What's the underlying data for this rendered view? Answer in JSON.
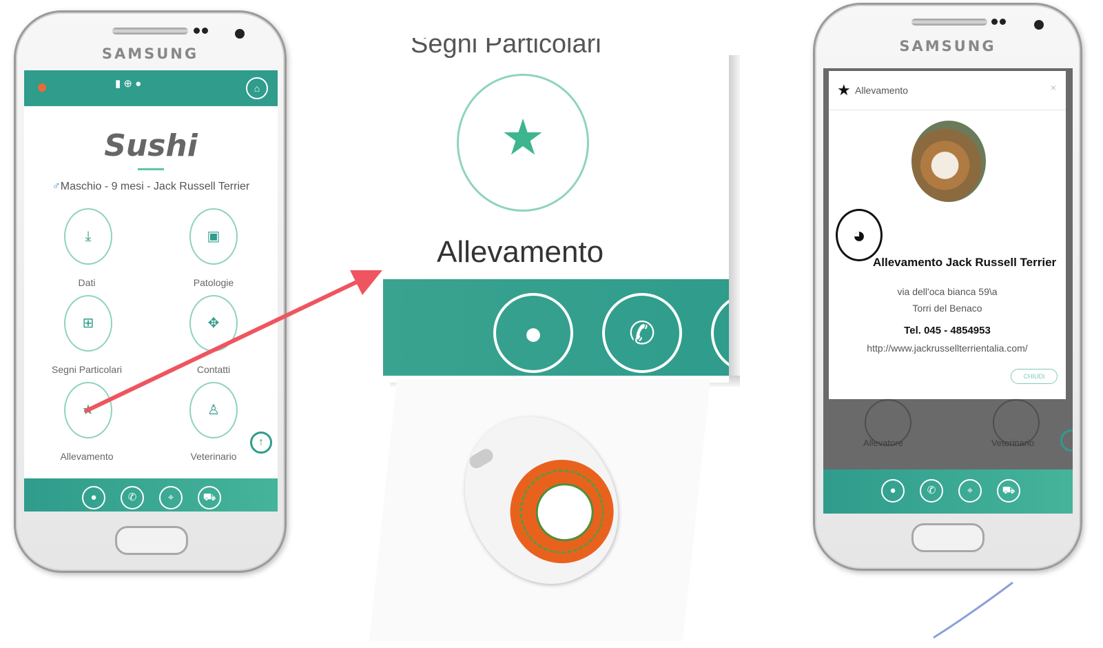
{
  "left_phone": {
    "brand": "SAMSUNG",
    "flags": "▮ ⊕ ●",
    "pet_name": "Sushi",
    "male_symbol": "♂",
    "pet_info": "Maschio - 9 mesi - Jack Russell Terrier",
    "menu": [
      {
        "label": "Dati",
        "icon": "download-icon"
      },
      {
        "label": "Patologie",
        "icon": "medical-bag-icon"
      },
      {
        "label": "Segni Particolari",
        "icon": "plus-box-icon"
      },
      {
        "label": "Contatti",
        "icon": "gift-icon"
      },
      {
        "label": "Allevamento",
        "icon": "star-icon"
      },
      {
        "label": "Veterinario",
        "icon": "user-md-icon"
      }
    ]
  },
  "zoom": {
    "title": "Segni Particolari",
    "label": "Allevamento"
  },
  "right_phone": {
    "brand": "SAMSUNG",
    "modal_title": "Allevamento",
    "breeder_name": "Allevamento Jack Russell Terrier",
    "address_line1": "via dell'oca bianca 59\\a",
    "address_line2": "Torri del Benaco",
    "phone": "Tel. 045 - 4854953",
    "website": "http://www.jackrussellterrientalia.com/",
    "close_button": "CHIUDI",
    "behind_labels": [
      "Allevatore",
      "Veterinario"
    ]
  },
  "colors": {
    "teal": "#2f9c8c",
    "mint": "#8fd3bd",
    "star": "#3db58f",
    "arrow": "#ee5560",
    "tag_orange": "#e8621e"
  }
}
